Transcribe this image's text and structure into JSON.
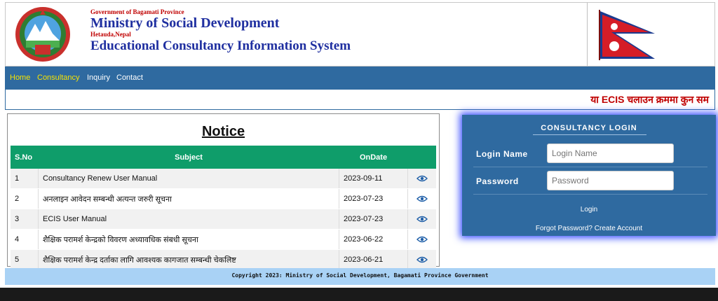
{
  "header": {
    "gov_line": "Government of Bagamati Province",
    "ministry": "Ministry of Social Development",
    "location": "Hetauda,Nepal",
    "system": "Educational Consultancy Information System"
  },
  "nav": {
    "items": [
      {
        "label": "Home"
      },
      {
        "label": "Consultancy"
      },
      {
        "label": "Inquiry"
      },
      {
        "label": "Contact"
      }
    ]
  },
  "marquee": "या ECIS चलाउन क्रममा कुन सम",
  "notice": {
    "title": "Notice",
    "columns": [
      "S.No",
      "Subject",
      "OnDate"
    ],
    "rows": [
      {
        "sno": "1",
        "subject": "Consultancy Renew User Manual",
        "date": "2023-09-11"
      },
      {
        "sno": "2",
        "subject": "अनलाइन आवेदन सम्बन्धी अत्यन्त जरुरी सूचना",
        "date": "2023-07-23"
      },
      {
        "sno": "3",
        "subject": "ECIS User Manual",
        "date": "2023-07-23"
      },
      {
        "sno": "4",
        "subject": "शैक्षिक परामर्श केन्द्रको विवरण अध्यावधिक संबधी सूचना",
        "date": "2023-06-22"
      },
      {
        "sno": "5",
        "subject": "शैक्षिक परामर्श केन्द्र दर्ताका लागि आवश्यक कागजात सम्बन्धी चेकलिष्ट",
        "date": "2023-06-21"
      }
    ]
  },
  "login": {
    "title": "CONSULTANCY LOGIN",
    "login_name_label": "Login Name",
    "login_name_placeholder": "Login Name",
    "password_label": "Password",
    "password_placeholder": "Password",
    "login_button": "Login",
    "links": "Forgot Password? Create Account"
  },
  "footer": "Copyright 2023: Ministry of Social Development, Bagamati Province Government",
  "colors": {
    "nav_bg": "#2f6aa0",
    "active_nav": "#f7e300",
    "table_header": "#0f9d6a",
    "title_blue": "#1f2fa0",
    "accent_red": "#c00000",
    "footer_bg": "#a9d2f5"
  },
  "icons": {
    "row_action": "eye-icon",
    "logo": "emblem-logo",
    "flag": "nepal-flag"
  }
}
